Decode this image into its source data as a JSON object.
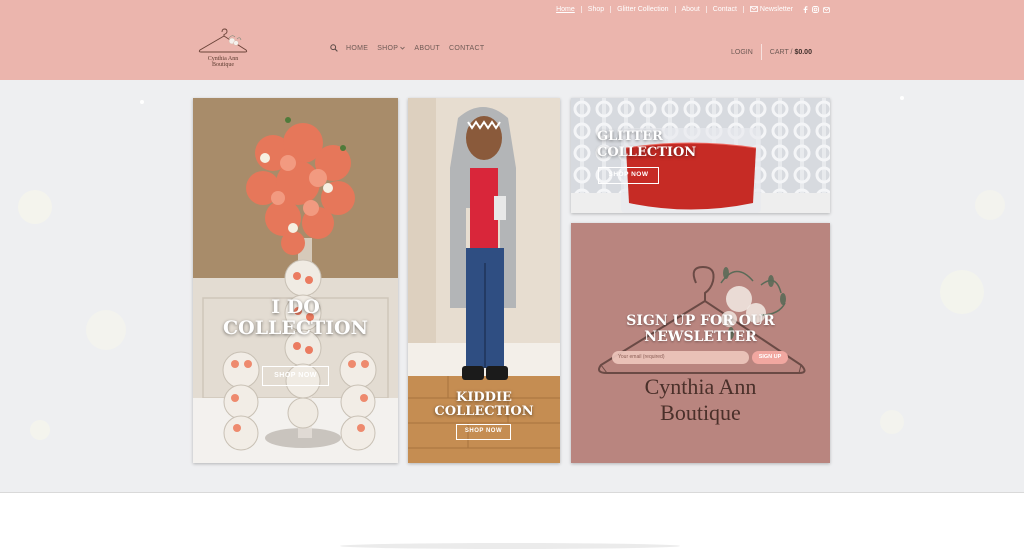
{
  "brand": {
    "name_line1": "Cynthia Ann",
    "name_line2": "Boutique"
  },
  "topbar": {
    "links": [
      "Home",
      "Shop",
      "Glitter Collection",
      "About",
      "Contact"
    ],
    "newsletter": "Newsletter"
  },
  "nav": {
    "items": [
      "HOME",
      "SHOP",
      "ABOUT",
      "CONTACT"
    ]
  },
  "account": {
    "login": "LOGIN",
    "cart_label": "CART /",
    "cart_total": "$0.00"
  },
  "cards": {
    "ido": {
      "title_line1": "I DO",
      "title_line2": "COLLECTION",
      "button": "SHOP NOW"
    },
    "kiddie": {
      "title_line1": "KIDDIE",
      "title_line2": "COLLECTION",
      "button": "SHOP NOW"
    },
    "glitter": {
      "title_line1": "GLITTER",
      "title_line2": "COLLECTION",
      "button": "SHOP NOW"
    },
    "newsletter": {
      "title_line1": "SIGN UP FOR OUR",
      "title_line2": "NEWSLETTER",
      "placeholder": "Your email (required)",
      "button": "SIGN UP",
      "logo_line1": "Cynthia Ann",
      "logo_line2": "Boutique"
    }
  },
  "colors": {
    "header_bg": "#ebb5ad",
    "page_bg": "#eeeff1",
    "newsletter_bg": "#b9857f",
    "accent": "#f1a7a0"
  }
}
